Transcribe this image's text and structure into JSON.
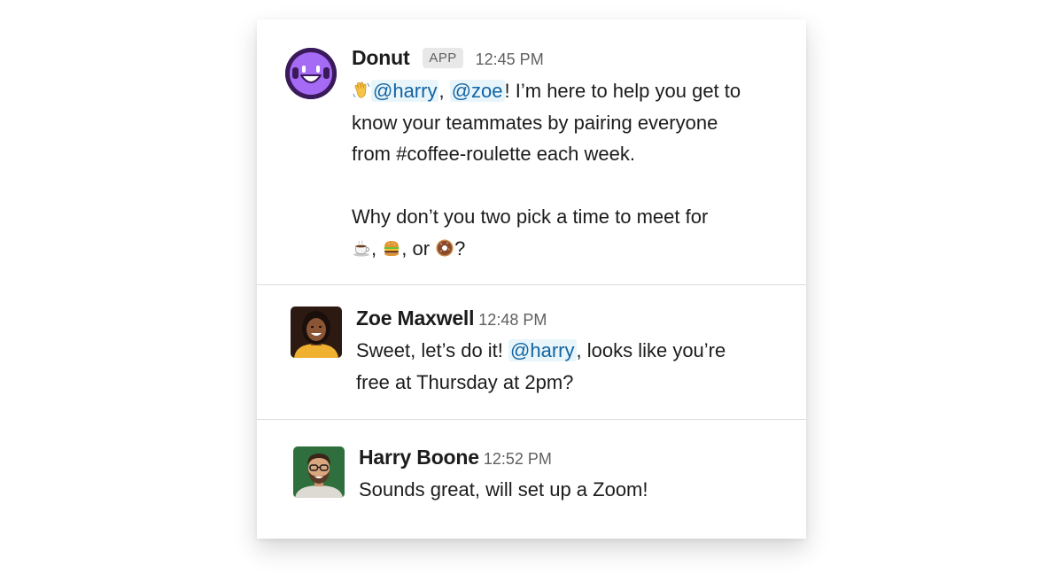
{
  "messages": [
    {
      "author": "Donut",
      "badge": "APP",
      "time": "12:45 PM",
      "avatar_icon": "donut-face-icon",
      "mention_harry": "@harry",
      "sep1": ",",
      "mention_zoe": "@zoe",
      "line1_rest": "! I’m here to help you get to",
      "line2": "know your teammates by pairing everyone",
      "line3": "from #coffee-roulette each week.",
      "line4": "Why don’t you two pick a time to meet for",
      "emoji_coffee": "coffee-emoji-icon",
      "sep2": ",",
      "emoji_burger": "burger-emoji-icon",
      "sep3": ", or",
      "emoji_donut": "donut-emoji-icon",
      "end": "?",
      "wave_icon": "waving-hand-emoji-icon"
    },
    {
      "author": "Zoe Maxwell",
      "time": "12:48 PM",
      "text_start": "Sweet, let’s do it!",
      "mention": "@harry",
      "text_rest": ", looks like you’re",
      "line2": "free at Thursday at 2pm?"
    },
    {
      "author": "Harry Boone",
      "time": "12:52 PM",
      "text": "Sounds great, will set up a Zoom!"
    }
  ],
  "colors": {
    "mention_text": "#1264a3",
    "mention_bg": "#e8f5fa",
    "donut_avatar_bg": "#3b1a5c",
    "donut_avatar_face": "#a66bf5"
  }
}
